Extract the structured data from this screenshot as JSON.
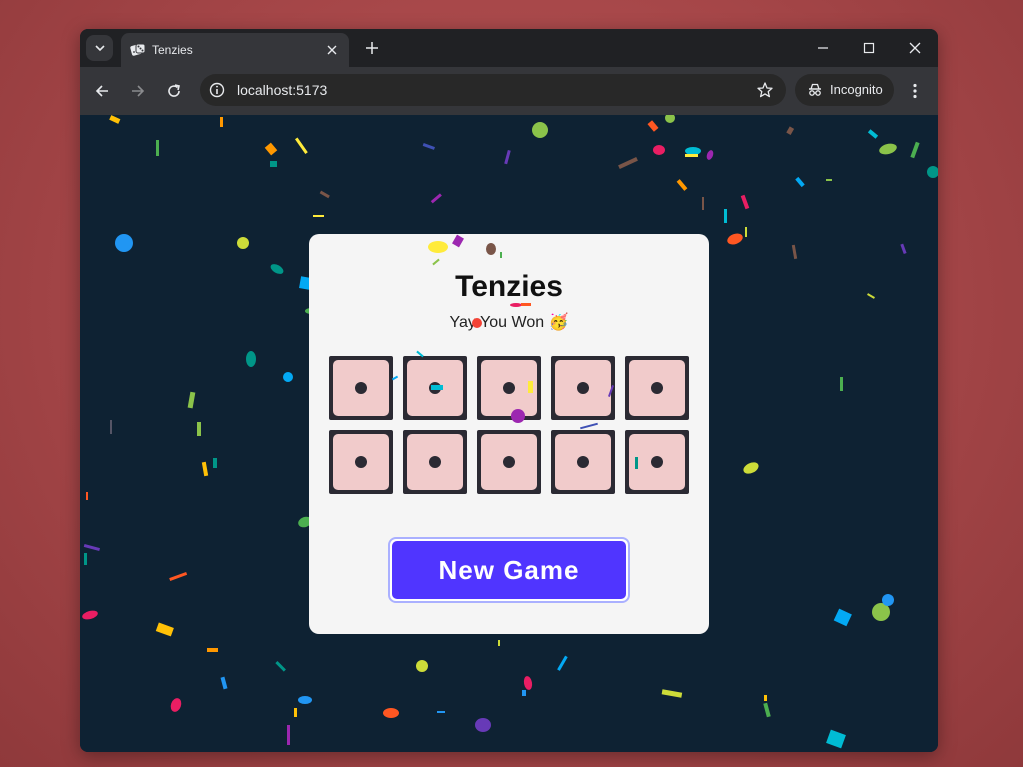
{
  "browser": {
    "tab_title": "Tenzies",
    "url": "localhost:5173",
    "incognito_label": "Incognito"
  },
  "game": {
    "title": "Tenzies",
    "status_message": "Yay You Won 🥳",
    "dice_values": [
      1,
      1,
      1,
      1,
      1,
      1,
      1,
      1,
      1,
      1
    ],
    "dice_held": [
      true,
      true,
      true,
      true,
      true,
      true,
      true,
      true,
      true,
      true
    ],
    "new_game_label": "New Game"
  },
  "colors": {
    "background": "#0e2233",
    "card": "#f5f5f5",
    "die_face": "#f1cbcb",
    "die_border": "#2b2a33",
    "button": "#5035ff"
  }
}
